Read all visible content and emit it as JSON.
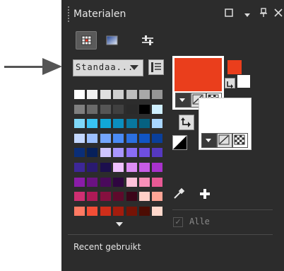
{
  "panel": {
    "title": "Materialen",
    "recent_label": "Recent gebruikt"
  },
  "titlebar_icons": [
    "maximize-icon",
    "menu-dropdown-icon",
    "pin-icon",
    "close-icon"
  ],
  "tabs": [
    {
      "name": "swatches-tab",
      "icon": "grid-icon",
      "active": true
    },
    {
      "name": "gradient-tab",
      "icon": "gradient-icon",
      "active": false
    },
    {
      "name": "adjust-tab",
      "icon": "sliders-icon",
      "active": false
    }
  ],
  "palette_dropdown": {
    "value": "Standaa..."
  },
  "swatch_colors": [
    [
      "#ffffff",
      "#f2f2f2",
      "#e0e0e0",
      "#cfcfcf",
      "#bdbdbd",
      "#a8a8a8",
      "#969696"
    ],
    [
      "#7f7f7f",
      "#6a6a6a",
      "#555555",
      "#404040",
      "#2a2a2a",
      "#000000",
      "#cfefff"
    ],
    [
      "#7fd8f8",
      "#39c3f2",
      "#11a8d8",
      "#0b8fbf",
      "#08779f",
      "#066180",
      "#a9d6ff"
    ],
    [
      "#c4d8ff",
      "#9cc0ff",
      "#74a6ff",
      "#4a8bf5",
      "#2b6fe0",
      "#1155c4",
      "#0a3f9a"
    ],
    [
      "#0a2e78",
      "#06205a",
      "#cfc4ff",
      "#a996ff",
      "#8a6df6",
      "#6e4ee0",
      "#5538c0"
    ],
    [
      "#3d2798",
      "#2a1a70",
      "#1c0f4e",
      "#f0c2ff",
      "#dd8ef5",
      "#c75ce6",
      "#a832cc"
    ],
    [
      "#8a1ca8",
      "#6b1282",
      "#4a0a5c",
      "#2f0640",
      "#ffc2da",
      "#f78fb8",
      "#e85a95"
    ],
    [
      "#cf2f72",
      "#ad1a56",
      "#86103f",
      "#5e0a2c",
      "#3c0519",
      "#ffcfc7",
      "#ffa596"
    ],
    [
      "#ff7a63",
      "#f24e36",
      "#cf2e1a",
      "#a31c0d",
      "#761306",
      "#4c0c03",
      "#ffd8cc"
    ]
  ],
  "colors": {
    "foreground": "#ea3e1c",
    "background": "#ffffff",
    "panel_bg": "#2c2c2c"
  },
  "alle": {
    "label": "Alle",
    "checked": true
  }
}
